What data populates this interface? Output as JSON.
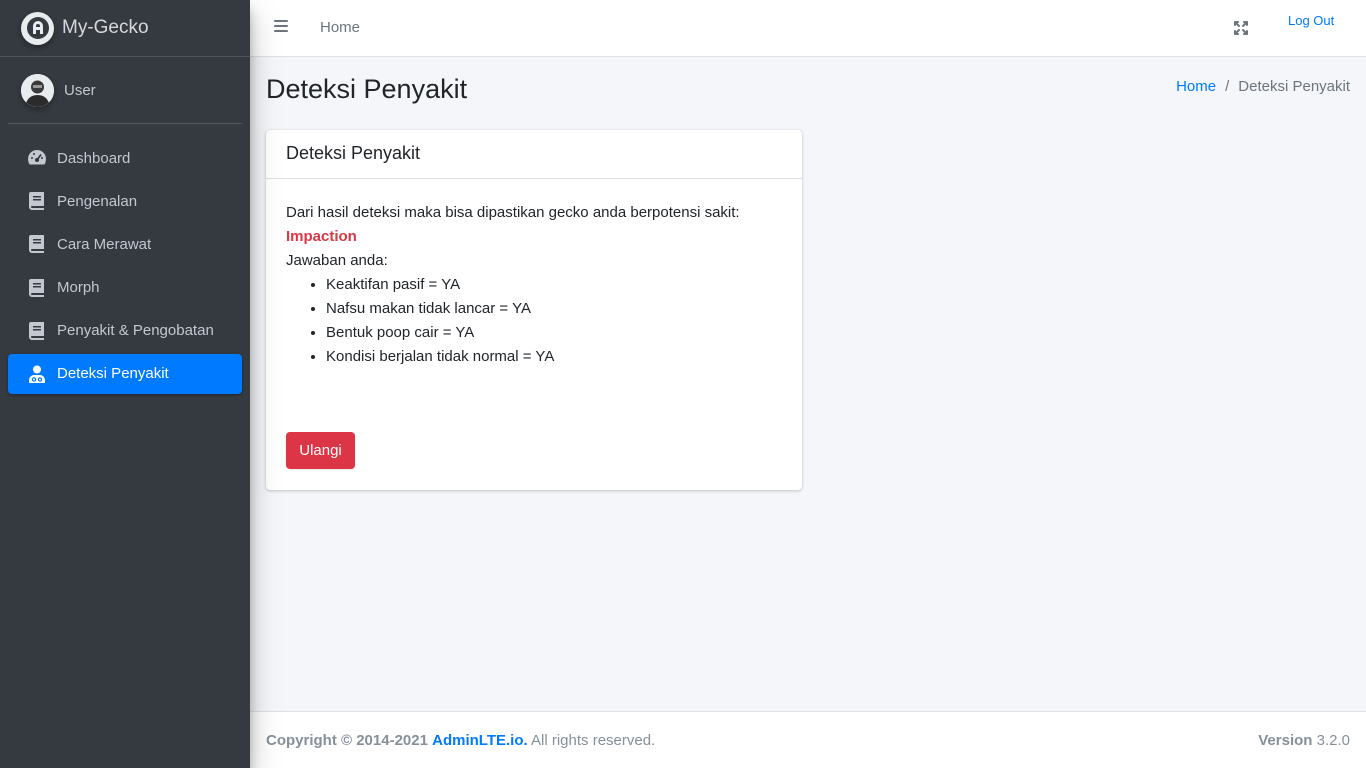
{
  "brand": {
    "name": "My-Gecko",
    "logo_icon": "adminlte-logo-icon"
  },
  "user": {
    "name": "User"
  },
  "sidebar": {
    "items": [
      {
        "label": "Dashboard",
        "icon": "tachometer-icon",
        "active": false
      },
      {
        "label": "Pengenalan",
        "icon": "book-icon",
        "active": false
      },
      {
        "label": "Cara Merawat",
        "icon": "book-icon",
        "active": false
      },
      {
        "label": "Morph",
        "icon": "book-icon",
        "active": false
      },
      {
        "label": "Penyakit & Pengobatan",
        "icon": "book-icon",
        "active": false
      },
      {
        "label": "Deteksi Penyakit",
        "icon": "user-md-icon",
        "active": true
      }
    ]
  },
  "topnav": {
    "home_label": "Home",
    "logout_label": "Log Out"
  },
  "page": {
    "title": "Deteksi Penyakit",
    "breadcrumb": {
      "home": "Home",
      "separator": "/",
      "current": "Deteksi Penyakit"
    }
  },
  "card": {
    "title": "Deteksi Penyakit",
    "intro": "Dari hasil deteksi maka bisa dipastikan gecko anda berpotensi sakit:",
    "disease": "Impaction",
    "answers_label": "Jawaban anda:",
    "answers": [
      "Keaktifan pasif = YA",
      "Nafsu makan tidak lancar = YA",
      "Bentuk poop cair = YA",
      "Kondisi berjalan tidak normal = YA"
    ],
    "retry_label": "Ulangi"
  },
  "footer": {
    "copyright": "Copyright © 2014-2021",
    "link": "AdminLTE.io.",
    "rights": "All rights reserved.",
    "version_label": "Version",
    "version": "3.2.0"
  },
  "colors": {
    "sidebar": "#343a40",
    "primary": "#007bff",
    "danger": "#dc3545",
    "background": "#f4f6f9"
  }
}
